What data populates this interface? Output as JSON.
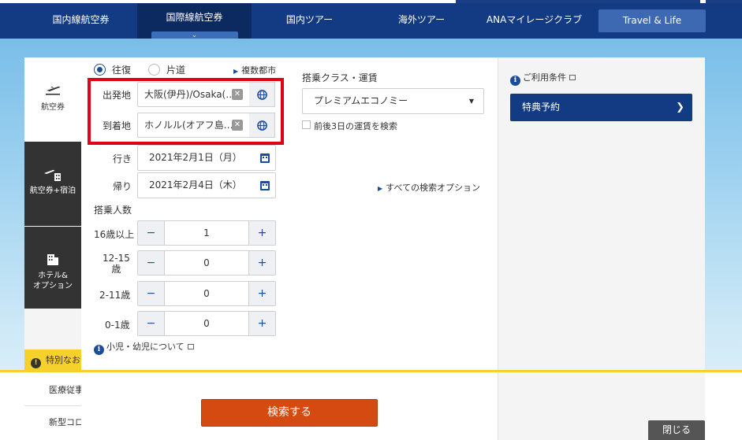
{
  "nav": {
    "items": [
      {
        "label": "国内線航空券"
      },
      {
        "label": "国際線航空券"
      },
      {
        "label": "国内ツアー"
      },
      {
        "label": "海外ツアー"
      },
      {
        "label": "ANAマイレージクラブ"
      },
      {
        "label": "Travel & Life"
      }
    ],
    "active_index": 1
  },
  "left_tabs": [
    {
      "label": "航空券",
      "icon": "airplane-icon"
    },
    {
      "label": "航空券+宿泊",
      "icon": "plane-building-icon"
    },
    {
      "label_line1": "ホテル&",
      "label_line2": "オプション",
      "icon": "building-icon"
    }
  ],
  "trip_type": {
    "options": [
      "往復",
      "片道"
    ],
    "selected": "往復",
    "multi_city": "複数都市"
  },
  "route": {
    "origin_label": "出発地",
    "origin_value": "大阪(伊丹)/Osaka(…",
    "destination_label": "到着地",
    "destination_value": "ホノルル(オアフ島…"
  },
  "dates": {
    "outbound_label": "行き",
    "outbound_value": "2021年2月1日（月）",
    "return_label": "帰り",
    "return_value": "2021年2月4日（木）"
  },
  "passengers": {
    "title": "搭乗人数",
    "rows": [
      {
        "label": "16歳以上",
        "value": "1"
      },
      {
        "label_line1": "12-15",
        "label_line2": "歳",
        "value": "0"
      },
      {
        "label": "2-11歳",
        "value": "0"
      },
      {
        "label": "0-1歳",
        "value": "0"
      }
    ],
    "minus": "−",
    "plus": "+",
    "child_info": "小児・幼児について"
  },
  "cabin": {
    "title": "搭乗クラス・運賃",
    "selected": "プレミアムエコノミー",
    "flex_checkbox": "前後3日の運賃を検索",
    "all_options": "すべての検索オプション"
  },
  "side": {
    "terms": "ご利用条件",
    "award_button": "特典予約"
  },
  "actions": {
    "search": "検索する",
    "close": "閉じる"
  },
  "notice": {
    "text": "特別なお"
  },
  "news": [
    {
      "text": "医療従事"
    },
    {
      "text": "新型コロ"
    }
  ],
  "colors": {
    "nav_bg": "#133b83",
    "accent": "#1c4d9c",
    "search_button": "#d54a10",
    "highlight_box": "#e00019",
    "notice": "#f6d02b"
  }
}
